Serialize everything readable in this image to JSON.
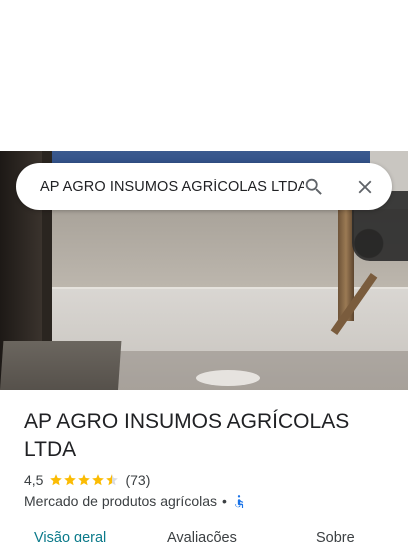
{
  "search": {
    "value": "AP AGRO INSUMOS AGRÍCOLAS LTDA",
    "search_icon": "search-icon",
    "close_icon": "close-icon"
  },
  "place": {
    "name": "AP AGRO INSUMOS AGRÍCOLAS LTDA",
    "rating": "4,5",
    "stars": 4.5,
    "review_count": "(73)",
    "category": "Mercado de produtos agrícolas",
    "separator": "•",
    "accessibility_icon": "wheelchair-icon"
  },
  "tabs": [
    {
      "label": "Visão geral",
      "active": true
    },
    {
      "label": "Avaliações",
      "active": false
    },
    {
      "label": "Sobre",
      "active": false
    }
  ],
  "colors": {
    "accent": "#0b7a8a",
    "star": "#fbbc04",
    "accessibility": "#1a73e8"
  }
}
